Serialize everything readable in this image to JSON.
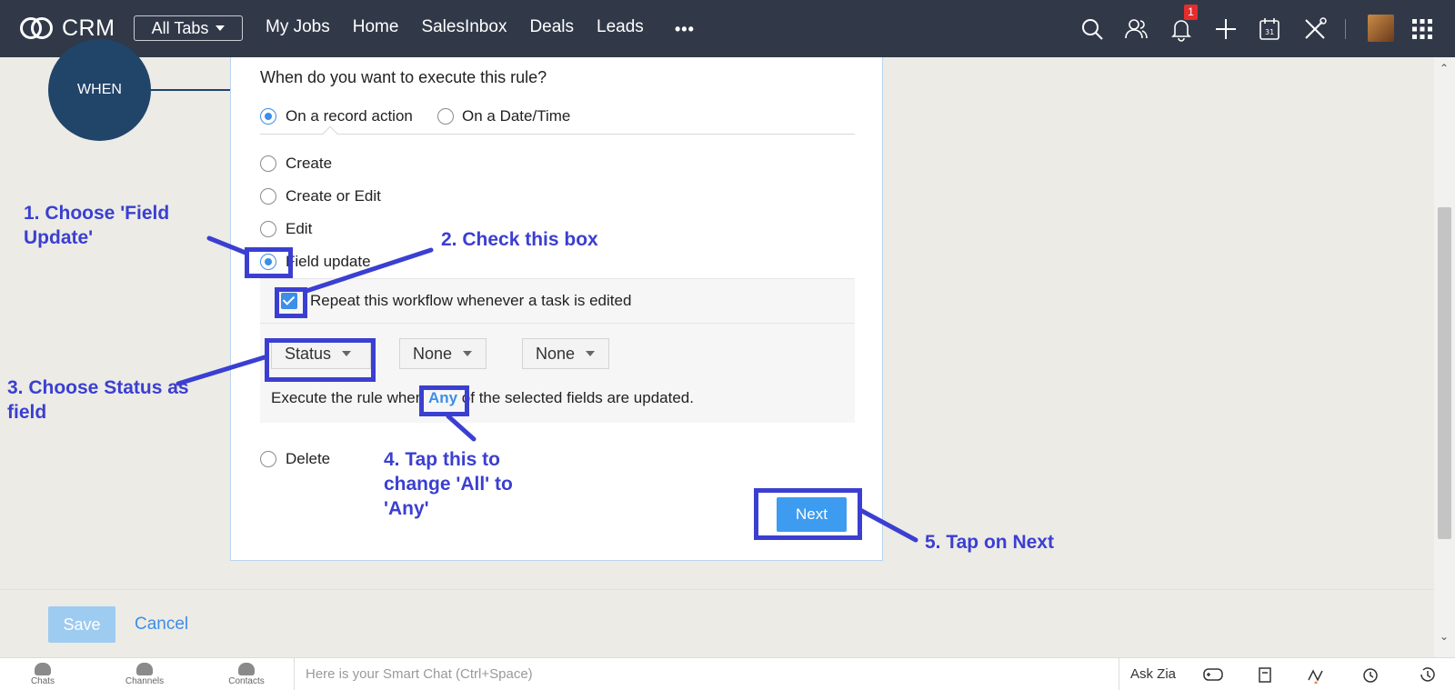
{
  "topbar": {
    "brand": "CRM",
    "all_tabs": "All Tabs",
    "nav": [
      "My Jobs",
      "Home",
      "SalesInbox",
      "Deals",
      "Leads"
    ],
    "more": "•••",
    "notification_count": "1",
    "icons": [
      "search-icon",
      "users-icon",
      "bell-icon",
      "plus-icon",
      "calendar-icon",
      "tools-icon",
      "avatar",
      "apps-grid-icon"
    ]
  },
  "workflow": {
    "step_label": "WHEN"
  },
  "panel": {
    "question": "When do you want to execute this rule?",
    "trigger_options": [
      {
        "label": "On a record action",
        "selected": true
      },
      {
        "label": "On a Date/Time",
        "selected": false
      }
    ],
    "actions": {
      "create": "Create",
      "create_or_edit": "Create or Edit",
      "edit": "Edit",
      "field_update": "Field update",
      "delete": "Delete"
    },
    "selected_action": "Field update",
    "repeat_label": "Repeat this workflow whenever a task is edited",
    "repeat_checked": true,
    "field_selects": [
      "Status",
      "None",
      "None"
    ],
    "exec_prefix": "Execute the rule when ",
    "exec_any": "Any",
    "exec_suffix": " of the selected fields are updated.",
    "next": "Next"
  },
  "footer": {
    "save": "Save",
    "cancel": "Cancel"
  },
  "bottombar": {
    "items": [
      "Chats",
      "Channels",
      "Contacts"
    ],
    "smartchat_placeholder": "Here is your Smart Chat (Ctrl+Space)",
    "ask_zia": "Ask Zia"
  },
  "annotations": {
    "step1": "1. Choose 'Field Update'",
    "step2": "2. Check this box",
    "step3": "3. Choose Status as field",
    "step4": "4. Tap this to change 'All' to 'Any'",
    "step5": "5. Tap on Next",
    "color": "#3b3fd1"
  },
  "colors": {
    "topbar": "#313949",
    "accent": "#3d8ee8",
    "when_circle": "#214469"
  }
}
